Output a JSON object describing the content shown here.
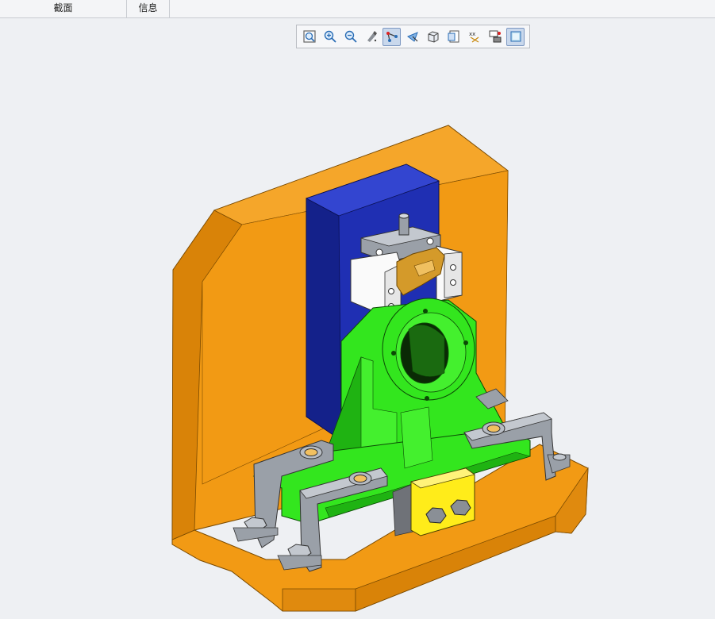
{
  "tabs": [
    {
      "label": "截面"
    },
    {
      "label": "信息"
    }
  ],
  "toolbar": {
    "buttons": [
      {
        "icon": "zoom-fit-icon"
      },
      {
        "icon": "zoom-in-icon"
      },
      {
        "icon": "zoom-out-icon"
      },
      {
        "icon": "repaint-icon"
      },
      {
        "icon": "spin-center-icon",
        "active": true
      },
      {
        "icon": "view-orient-icon"
      },
      {
        "icon": "saved-views-icon"
      },
      {
        "icon": "appearance-icon"
      },
      {
        "icon": "datum-display-icon"
      },
      {
        "icon": "annotation-display-icon"
      },
      {
        "icon": "display-style-icon",
        "active": true
      }
    ]
  },
  "model": {
    "colors": {
      "base_orange": "#f29a14",
      "base_dark": "#c9790c",
      "plate_blue": "#1f2fb3",
      "support_green": "#33e61e",
      "green_dark": "#1fb312",
      "clamp_gray": "#9aa0a8",
      "block_white": "#fafafa",
      "wedge_gold": "#d49a2a",
      "bracket_yellow": "#ffec1a"
    }
  }
}
